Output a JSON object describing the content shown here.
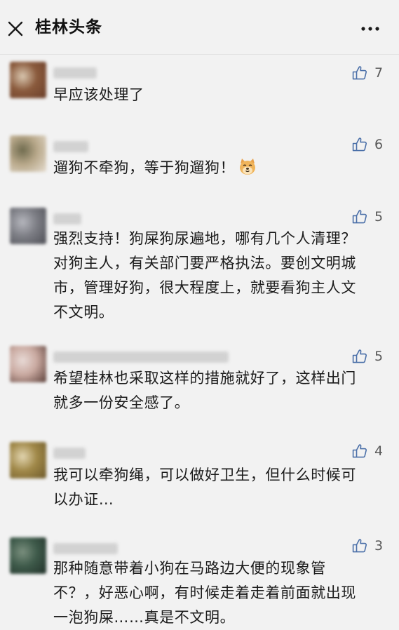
{
  "header": {
    "title": "桂林头条",
    "close_icon": "close-icon",
    "more_icon": "more-icon"
  },
  "comments": [
    {
      "likes": "7",
      "text": "早应该处理了",
      "avatar_colors": [
        "#8a5a3c",
        "#d9c7b0",
        "#6b3f2a"
      ]
    },
    {
      "likes": "6",
      "text": "遛狗不牵狗，等于狗遛狗！",
      "emoji": "dog-face-emoji",
      "avatar_colors": [
        "#b8a88a",
        "#6f6b4e",
        "#e6ddd0"
      ]
    },
    {
      "likes": "5",
      "text": "强烈支持！狗屎狗尿遍地，哪有几个人清理？\n对狗主人，有关部门要严格执法。要创文明城\n市，管理好狗，很大程度上，就要看狗主人文\n不文明。",
      "avatar_colors": [
        "#7c7d84",
        "#b5b6bd",
        "#4f5057"
      ]
    },
    {
      "likes": "5",
      "text": "希望桂林也采取这样的措施就好了，这样出门\n就多一份安全感了。",
      "avatar_colors": [
        "#c9a9a0",
        "#e8dad6",
        "#5a3e38"
      ]
    },
    {
      "likes": "4",
      "text": "我可以牵狗绳，可以做好卫生，但什么时候可\n以办证…",
      "avatar_colors": [
        "#a08848",
        "#e2d5b0",
        "#6e5a2a"
      ]
    },
    {
      "likes": "3",
      "text": "那种随意带着小狗在马路边大便的现象管\n不？，好恶心啊，有时候走着走着前面就出现\n一泡狗屎……真是不文明。",
      "avatar_colors": [
        "#3e5a4a",
        "#7a8f7e",
        "#22322a"
      ]
    }
  ]
}
